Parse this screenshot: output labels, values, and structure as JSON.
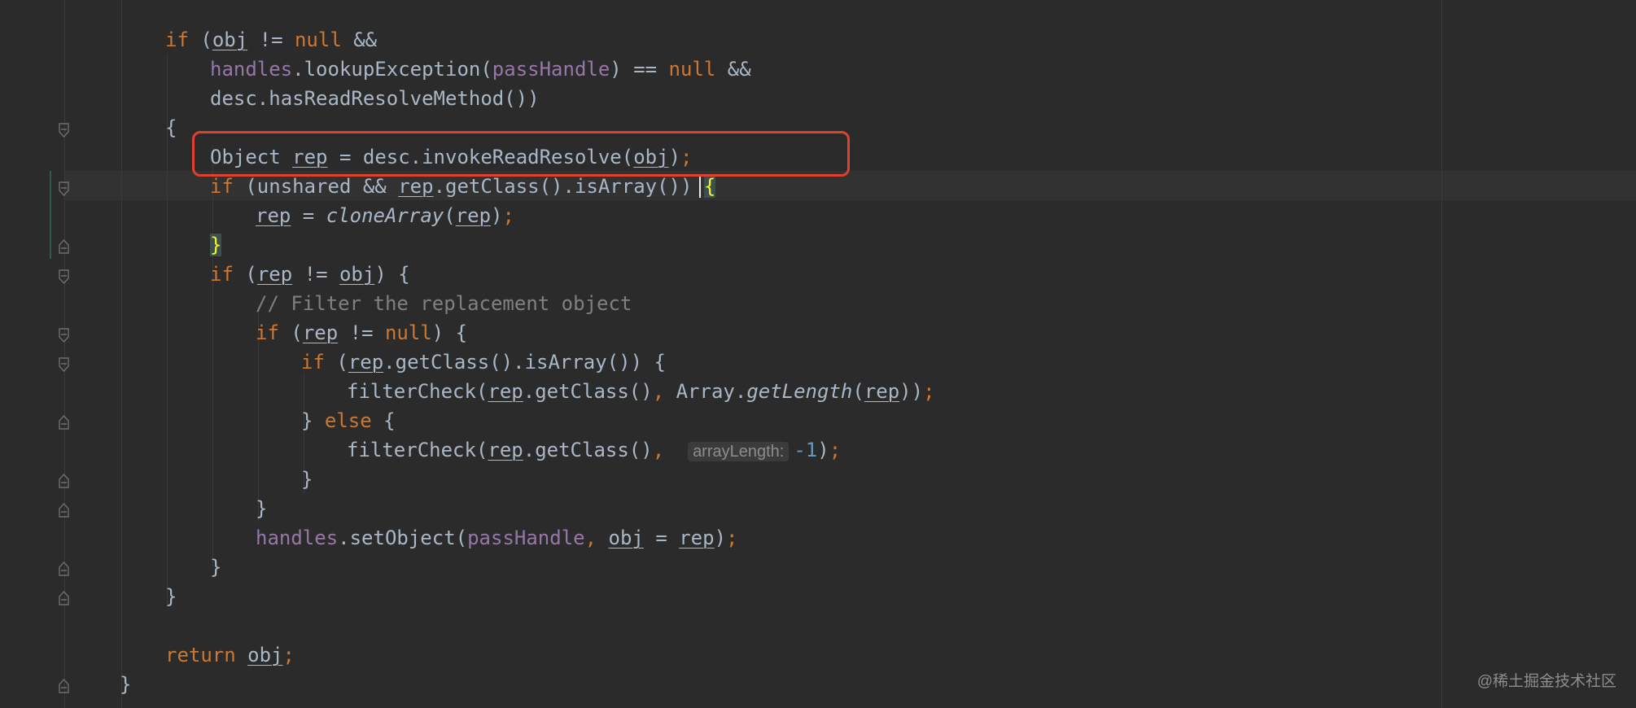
{
  "code": {
    "lines": [
      {
        "id": "if-open",
        "tokens": [
          {
            "t": "if ",
            "c": "kw"
          },
          {
            "t": "("
          },
          {
            "t": "obj",
            "c": "var"
          },
          {
            "t": " != "
          },
          {
            "t": "null",
            "c": "kw"
          },
          {
            "t": " &&"
          }
        ]
      },
      {
        "id": "lookup",
        "tokens": [
          {
            "t": "handles",
            "c": "fld"
          },
          {
            "t": ".lookupException("
          },
          {
            "t": "passHandle",
            "c": "fld"
          },
          {
            "t": ") == "
          },
          {
            "t": "null",
            "c": "kw"
          },
          {
            "t": " &&"
          }
        ]
      },
      {
        "id": "hasread",
        "tokens": [
          {
            "t": "desc.hasReadResolveMethod())"
          }
        ]
      },
      {
        "id": "brace1",
        "tokens": [
          {
            "t": "{"
          }
        ]
      },
      {
        "id": "invoke",
        "tokens": [
          {
            "t": "Object "
          },
          {
            "t": "rep",
            "c": "var"
          },
          {
            "t": " = desc.invokeReadResolve("
          },
          {
            "t": "obj",
            "c": "var"
          },
          {
            "t": ")"
          },
          {
            "t": ";",
            "c": "kw"
          }
        ]
      },
      {
        "id": "if-unshared",
        "tokens": [
          {
            "t": "if",
            "c": "kw"
          },
          {
            "t": " (unshared && "
          },
          {
            "t": "rep",
            "c": "var"
          },
          {
            "t": ".getClass().isArray()) "
          },
          {
            "t": "{",
            "c": "brace-hl"
          }
        ]
      },
      {
        "id": "clone",
        "tokens": [
          {
            "t": "rep",
            "c": "var"
          },
          {
            "t": " = "
          },
          {
            "t": "cloneArray",
            "c": "it"
          },
          {
            "t": "("
          },
          {
            "t": "rep",
            "c": "var"
          },
          {
            "t": ")"
          },
          {
            "t": ";",
            "c": "kw"
          }
        ]
      },
      {
        "id": "close-unshared",
        "tokens": [
          {
            "t": "}",
            "c": "brace-hl"
          }
        ]
      },
      {
        "id": "if-rep-obj",
        "tokens": [
          {
            "t": "if",
            "c": "kw"
          },
          {
            "t": " ("
          },
          {
            "t": "rep",
            "c": "var"
          },
          {
            "t": " != "
          },
          {
            "t": "obj",
            "c": "var"
          },
          {
            "t": ") {"
          }
        ]
      },
      {
        "id": "comment",
        "tokens": [
          {
            "t": "// Filter the replacement object",
            "c": "cm"
          }
        ]
      },
      {
        "id": "if-rep-null",
        "tokens": [
          {
            "t": "if",
            "c": "kw"
          },
          {
            "t": " ("
          },
          {
            "t": "rep",
            "c": "var"
          },
          {
            "t": " != "
          },
          {
            "t": "null",
            "c": "kw"
          },
          {
            "t": ") {"
          }
        ]
      },
      {
        "id": "if-isarray",
        "tokens": [
          {
            "t": "if",
            "c": "kw"
          },
          {
            "t": " ("
          },
          {
            "t": "rep",
            "c": "var"
          },
          {
            "t": ".getClass().isArray()) {"
          }
        ]
      },
      {
        "id": "filter1",
        "tokens": [
          {
            "t": "filterCheck("
          },
          {
            "t": "rep",
            "c": "var"
          },
          {
            "t": ".getClass()"
          },
          {
            "t": ",",
            "c": "kw"
          },
          {
            "t": " Array."
          },
          {
            "t": "getLength",
            "c": "it"
          },
          {
            "t": "("
          },
          {
            "t": "rep",
            "c": "var"
          },
          {
            "t": "))"
          },
          {
            "t": ";",
            "c": "kw"
          }
        ]
      },
      {
        "id": "else",
        "tokens": [
          {
            "t": "} "
          },
          {
            "t": "else",
            "c": "kw"
          },
          {
            "t": " {"
          }
        ]
      },
      {
        "id": "filter2",
        "tokens": [
          {
            "t": "filterCheck("
          },
          {
            "t": "rep",
            "c": "var"
          },
          {
            "t": ".getClass()"
          },
          {
            "t": ",",
            "c": "kw"
          },
          {
            "t": "  "
          },
          {
            "t": "arrayLength:",
            "c": "hint"
          },
          {
            "t": "-1",
            "c": "num"
          },
          {
            "t": ")"
          },
          {
            "t": ";",
            "c": "kw"
          }
        ]
      },
      {
        "id": "close-else",
        "tokens": [
          {
            "t": "}"
          }
        ]
      },
      {
        "id": "close-null",
        "tokens": [
          {
            "t": "}"
          }
        ]
      },
      {
        "id": "setobject",
        "tokens": [
          {
            "t": "handles",
            "c": "fld"
          },
          {
            "t": ".setObject("
          },
          {
            "t": "passHandle",
            "c": "fld"
          },
          {
            "t": ",",
            "c": "kw"
          },
          {
            "t": " "
          },
          {
            "t": "obj",
            "c": "var"
          },
          {
            "t": " = "
          },
          {
            "t": "rep",
            "c": "var"
          },
          {
            "t": ")"
          },
          {
            "t": ";",
            "c": "kw"
          }
        ]
      },
      {
        "id": "close-repobj",
        "tokens": [
          {
            "t": "}"
          }
        ]
      },
      {
        "id": "close-brace1",
        "tokens": [
          {
            "t": "}"
          }
        ]
      },
      {
        "id": "blank",
        "tokens": []
      },
      {
        "id": "return",
        "tokens": [
          {
            "t": "return ",
            "c": "kw"
          },
          {
            "t": "obj",
            "c": "var"
          },
          {
            "t": ";",
            "c": "kw"
          }
        ]
      },
      {
        "id": "close-method",
        "tokens": [
          {
            "t": "}"
          }
        ]
      }
    ]
  },
  "watermark": "@稀土掘金技术社区",
  "colors": {
    "background": "#2b2b2b",
    "keyword": "#cc7832",
    "field": "#9876aa",
    "default": "#a9b7c6",
    "comment": "#808080",
    "number": "#6897bb",
    "highlight_box": "#e0402e"
  }
}
